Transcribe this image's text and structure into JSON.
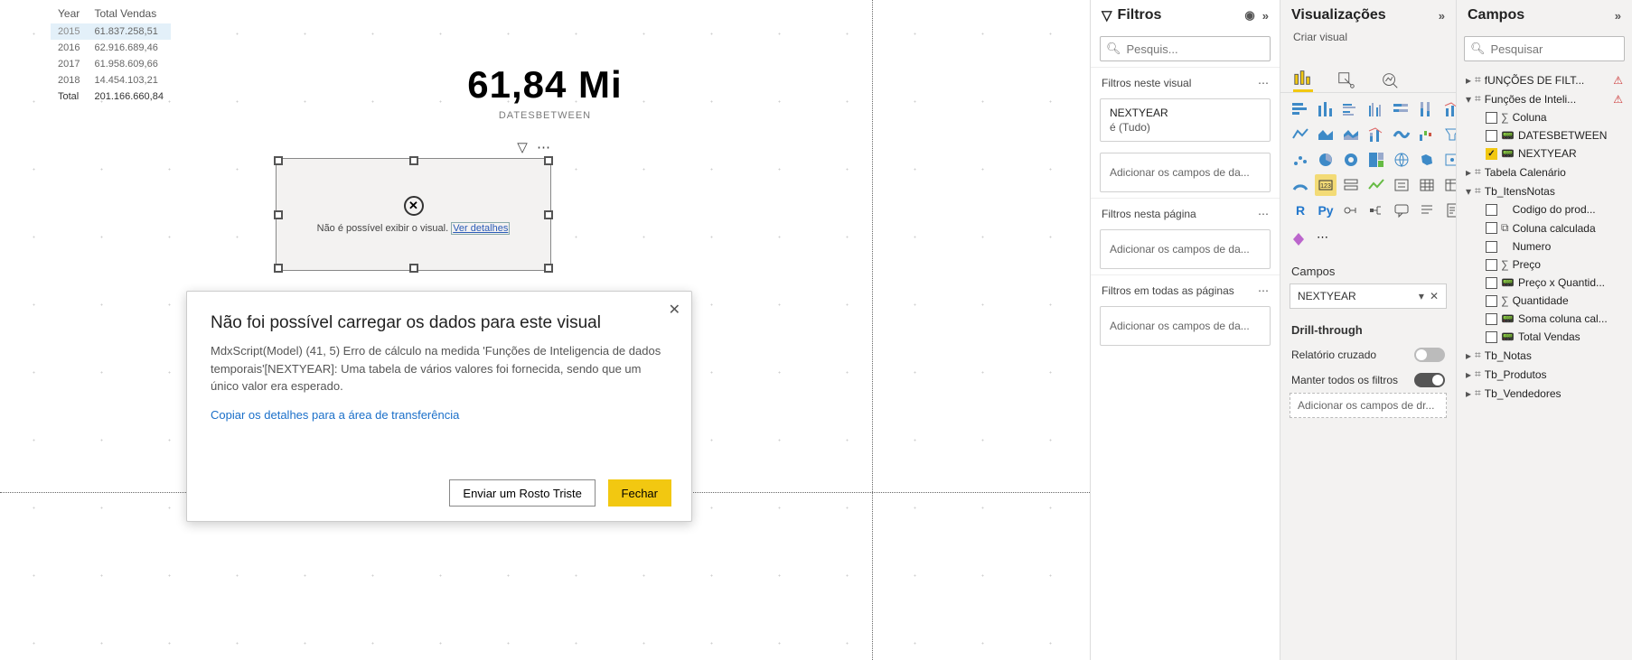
{
  "report_table": {
    "headers": [
      "Year",
      "Total Vendas"
    ],
    "rows": [
      {
        "year": "2015",
        "value": "61.837.258,51",
        "sel": true
      },
      {
        "year": "2016",
        "value": "62.916.689,46",
        "sel": false
      },
      {
        "year": "2017",
        "value": "61.958.609,66",
        "sel": false
      },
      {
        "year": "2018",
        "value": "14.454.103,21",
        "sel": false
      }
    ],
    "total_label": "Total",
    "total_value": "201.166.660,84"
  },
  "card": {
    "value": "61,84 Mi",
    "label": "DATESBETWEEN"
  },
  "error_visual": {
    "message": "Não é possível exibir o visual.",
    "link": "Ver detalhes"
  },
  "dialog": {
    "title": "Não foi possível carregar os dados para este visual",
    "body": "MdxScript(Model) (41, 5) Erro de cálculo na medida 'Funções de Inteligencia de dados temporais'[NEXTYEAR]: Uma tabela de vários valores foi fornecida, sendo que um único valor era esperado.",
    "copy_link": "Copiar os detalhes para a área de transferência",
    "btn_secondary": "Enviar um Rosto Triste",
    "btn_primary": "Fechar"
  },
  "filters_panel": {
    "title": "Filtros",
    "search_placeholder": "Pesquis...",
    "section_visual": "Filtros neste visual",
    "field_name": "NEXTYEAR",
    "field_value": "é (Tudo)",
    "add_data": "Adicionar os campos de da...",
    "section_page": "Filtros nesta página",
    "section_all": "Filtros em todas as páginas"
  },
  "viz_panel": {
    "title": "Visualizações",
    "subtitle": "Criar visual",
    "fields_header": "Campos",
    "field_well": "NEXTYEAR",
    "drill_header": "Drill-through",
    "cross_report": "Relatório cruzado",
    "keep_all": "Manter todos os filtros",
    "add_drill": "Adicionar os campos de dr..."
  },
  "fields_panel": {
    "title": "Campos",
    "search_placeholder": "Pesquisar",
    "tables": [
      {
        "name": "fUNÇÕES DE FILT...",
        "warn": true,
        "expanded": false,
        "kind": "table"
      },
      {
        "name": "Funções de Inteli...",
        "warn": true,
        "expanded": true,
        "kind": "table",
        "children": [
          {
            "name": "Coluna",
            "icon": "sigma",
            "checked": false
          },
          {
            "name": "DATESBETWEEN",
            "icon": "calc",
            "checked": false
          },
          {
            "name": "NEXTYEAR",
            "icon": "calc",
            "checked": true
          }
        ]
      },
      {
        "name": "Tabela Calenário",
        "expanded": false,
        "kind": "table"
      },
      {
        "name": "Tb_ItensNotas",
        "expanded": true,
        "kind": "table",
        "children": [
          {
            "name": "Codigo do prod...",
            "icon": "none",
            "checked": false
          },
          {
            "name": "Coluna calculada",
            "icon": "colcalc",
            "checked": false
          },
          {
            "name": "Numero",
            "icon": "none",
            "checked": false
          },
          {
            "name": "Preço",
            "icon": "sigma",
            "checked": false
          },
          {
            "name": "Preço x Quantid...",
            "icon": "calc",
            "checked": false
          },
          {
            "name": "Quantidade",
            "icon": "sigma",
            "checked": false
          },
          {
            "name": "Soma coluna cal...",
            "icon": "calc",
            "checked": false
          },
          {
            "name": "Total Vendas",
            "icon": "calc",
            "checked": false
          }
        ]
      },
      {
        "name": "Tb_Notas",
        "expanded": false,
        "kind": "table"
      },
      {
        "name": "Tb_Produtos",
        "expanded": false,
        "kind": "table"
      },
      {
        "name": "Tb_Vendedores",
        "expanded": false,
        "kind": "table"
      }
    ]
  }
}
